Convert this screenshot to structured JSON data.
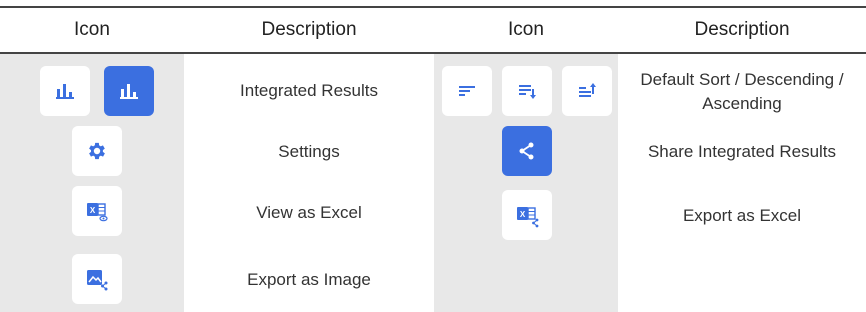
{
  "headers": {
    "icon_left": "Icon",
    "desc_left": "Description",
    "icon_right": "Icon",
    "desc_right": "Description"
  },
  "left_rows": [
    {
      "label": "Integrated Results",
      "icons": [
        "bar-chart-icon",
        "bar-chart-icon-active"
      ]
    },
    {
      "label": "Settings",
      "icons": [
        "gear-icon"
      ]
    },
    {
      "label": "View as Excel",
      "icons": [
        "excel-view-icon"
      ]
    },
    {
      "label": "Export as Image",
      "icons": [
        "image-share-icon"
      ]
    }
  ],
  "right_rows": [
    {
      "label": "Default Sort / Descending / Ascending",
      "icons": [
        "sort-default-icon",
        "sort-descending-icon",
        "sort-ascending-icon"
      ]
    },
    {
      "label": "Share Integrated Results",
      "icons": [
        "share-icon"
      ]
    },
    {
      "label": "Export as Excel",
      "icons": [
        "excel-share-icon"
      ]
    }
  ],
  "colors": {
    "accent": "#3b6fe0",
    "icon_blue": "#3b6fe0",
    "column_bg": "#e8e8e8",
    "rule": "#444444"
  }
}
